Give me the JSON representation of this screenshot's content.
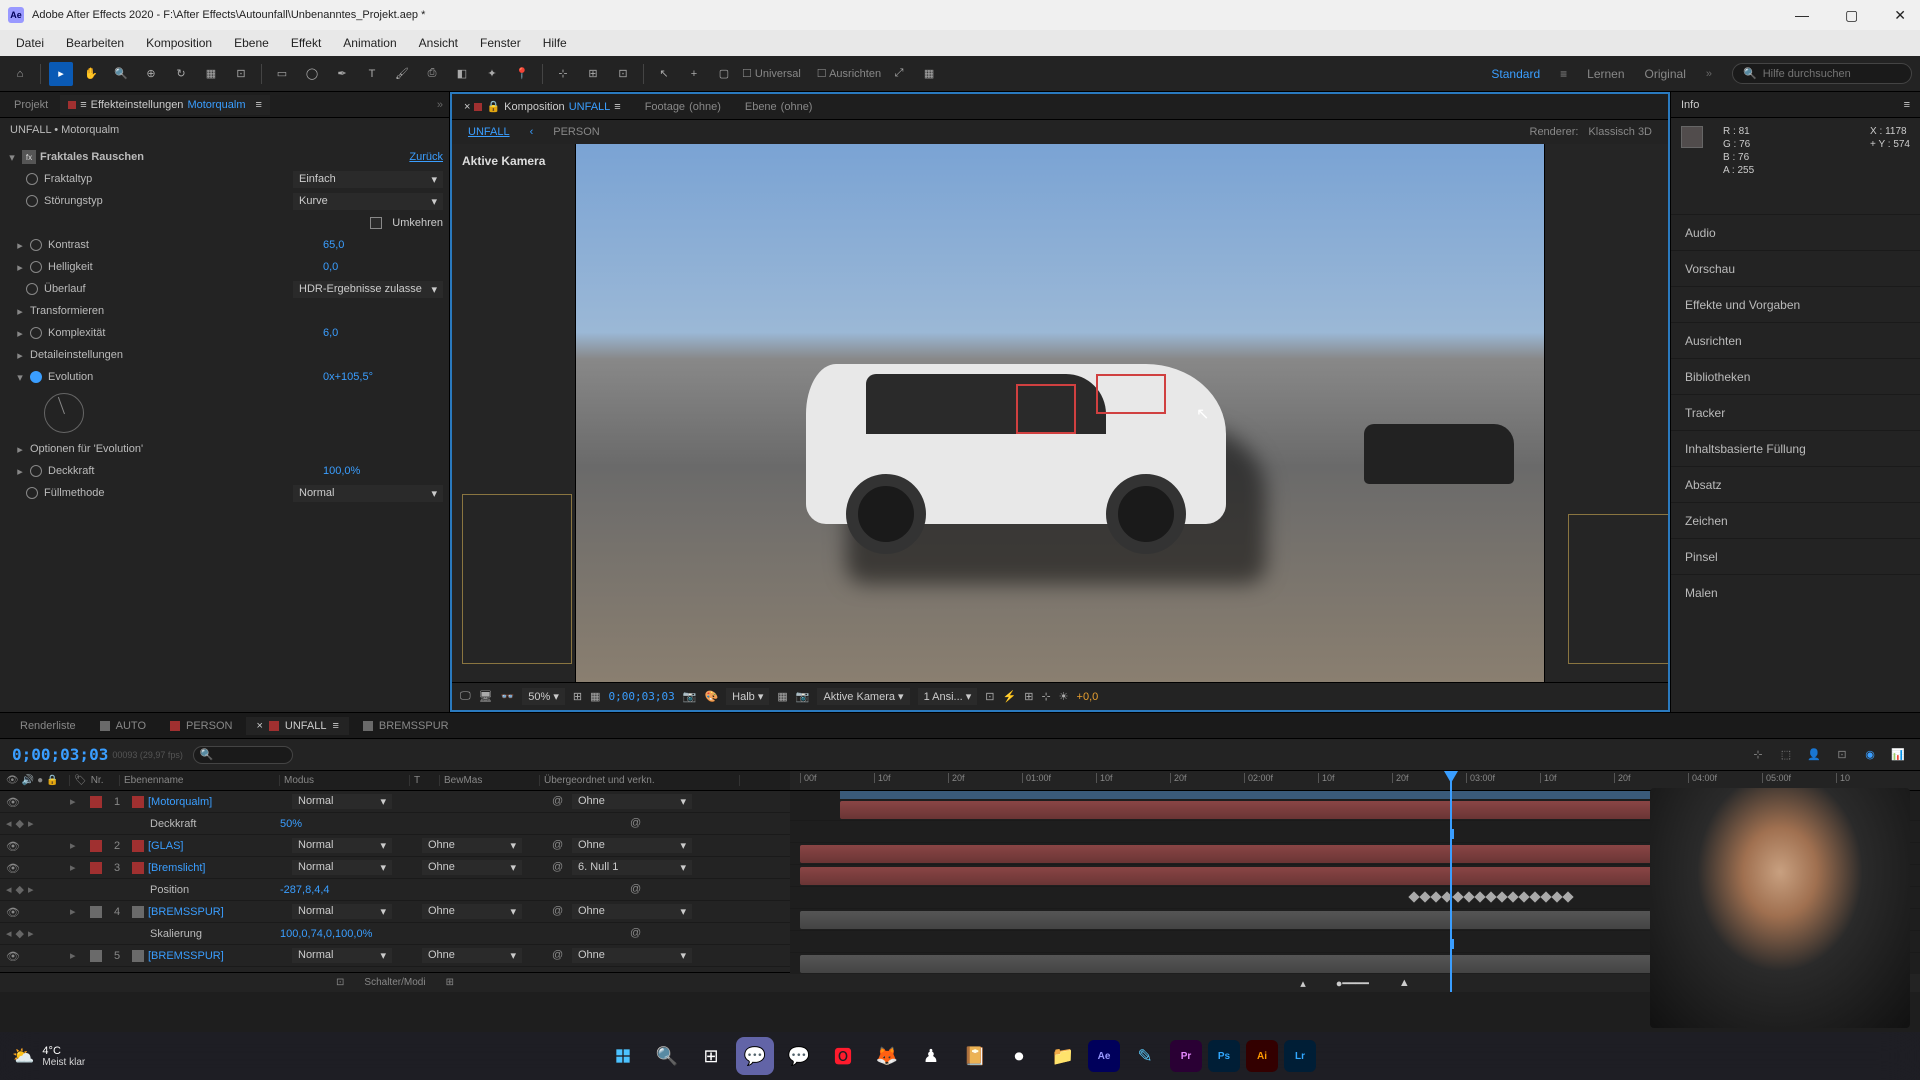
{
  "title": "Adobe After Effects 2020 - F:\\After Effects\\Autounfall\\Unbenanntes_Projekt.aep *",
  "menu": [
    "Datei",
    "Bearbeiten",
    "Komposition",
    "Ebene",
    "Effekt",
    "Animation",
    "Ansicht",
    "Fenster",
    "Hilfe"
  ],
  "toolbar": {
    "snapping": "Universal",
    "align": "Ausrichten"
  },
  "workspaces": {
    "standard": "Standard",
    "learn": "Lernen",
    "original": "Original"
  },
  "search_placeholder": "Hilfe durchsuchen",
  "left_panel": {
    "project_tab": "Projekt",
    "fx_tab": "Effekteinstellungen",
    "fx_target": "Motorqualm",
    "breadcrumb": "UNFALL • Motorqualm",
    "effect_name": "Fraktales Rauschen",
    "reset": "Zurück",
    "props": {
      "fraktaltyp": {
        "label": "Fraktaltyp",
        "value": "Einfach"
      },
      "stoerung": {
        "label": "Störungstyp",
        "value": "Kurve"
      },
      "umkehren": {
        "label": "Umkehren"
      },
      "kontrast": {
        "label": "Kontrast",
        "value": "65,0"
      },
      "helligkeit": {
        "label": "Helligkeit",
        "value": "0,0"
      },
      "ueberlauf": {
        "label": "Überlauf",
        "value": "HDR-Ergebnisse zulasse"
      },
      "transform": {
        "label": "Transformieren"
      },
      "komplex": {
        "label": "Komplexität",
        "value": "6,0"
      },
      "detail": {
        "label": "Detaileinstellungen"
      },
      "evolution": {
        "label": "Evolution",
        "value": "0x+105,5°"
      },
      "evo_opt": {
        "label": "Optionen für 'Evolution'"
      },
      "deckkraft": {
        "label": "Deckkraft",
        "value": "100,0%"
      },
      "fuell": {
        "label": "Füllmethode",
        "value": "Normal"
      }
    }
  },
  "comp": {
    "tab_label": "Komposition",
    "tab_name": "UNFALL",
    "footage": "Footage",
    "none": "(ohne)",
    "layer": "Ebene",
    "sub_active": "UNFALL",
    "sub_back": "‹",
    "sub_person": "PERSON",
    "renderer_label": "Renderer:",
    "renderer": "Klassisch 3D",
    "active_cam": "Aktive Kamera"
  },
  "viewer_controls": {
    "zoom": "50%",
    "time": "0;00;03;03",
    "res": "Halb",
    "camera": "Aktive Kamera",
    "views": "1 Ansi...",
    "exposure": "+0,0"
  },
  "info": {
    "tab": "Info",
    "r": "R :",
    "r_v": "81",
    "g": "G :",
    "g_v": "76",
    "b": "B :",
    "b_v": "76",
    "a": "A :",
    "a_v": "255",
    "x": "X :",
    "x_v": "1178",
    "y": "Y :",
    "y_v": "574"
  },
  "side_panels": [
    "Audio",
    "Vorschau",
    "Effekte und Vorgaben",
    "Ausrichten",
    "Bibliotheken",
    "Tracker",
    "Inhaltsbasierte Füllung",
    "Absatz",
    "Zeichen",
    "Pinsel",
    "Malen"
  ],
  "timeline": {
    "tabs": {
      "render": "Renderliste",
      "auto": "AUTO",
      "person": "PERSON",
      "unfall": "UNFALL",
      "brems": "BREMSSPUR"
    },
    "timecode": "0;00;03;03",
    "timecode_sub": "00093 (29,97 fps)",
    "cols": {
      "nr": "Nr.",
      "name": "Ebenenname",
      "mode": "Modus",
      "trk": "T",
      "bew": "BewMas",
      "parent": "Übergeordnet und verkn."
    },
    "layers": [
      {
        "idx": "1",
        "name": "[Motorqualm]",
        "mode": "Normal",
        "parent": "Ohne",
        "color": "#a03030",
        "props": [
          {
            "name": "Deckkraft",
            "value": "50%"
          }
        ]
      },
      {
        "idx": "2",
        "name": "[GLAS]",
        "mode": "Normal",
        "trk": "Ohne",
        "parent": "Ohne",
        "color": "#a03030"
      },
      {
        "idx": "3",
        "name": "[Bremslicht]",
        "mode": "Normal",
        "trk": "Ohne",
        "parent": "6. Null 1",
        "color": "#a03030",
        "props": [
          {
            "name": "Position",
            "value": "-287,8,4,4"
          }
        ]
      },
      {
        "idx": "4",
        "name": "[BREMSSPUR]",
        "mode": "Normal",
        "trk": "Ohne",
        "parent": "Ohne",
        "color": "#6a6a6a",
        "props": [
          {
            "name": "Skalierung",
            "value": "100,0,74,0,100,0%"
          }
        ]
      },
      {
        "idx": "5",
        "name": "[BREMSSPUR]",
        "mode": "Normal",
        "trk": "Ohne",
        "parent": "Ohne",
        "color": "#6a6a6a"
      }
    ],
    "ruler": [
      "00f",
      "10f",
      "20f",
      "01:00f",
      "10f",
      "20f",
      "02:00f",
      "10f",
      "20f",
      "03:00f",
      "10f",
      "20f",
      "04:00f",
      "05:00f",
      "10"
    ],
    "footer": "Schalter/Modi"
  },
  "taskbar": {
    "temp": "4°C",
    "weather": "Meist klar"
  }
}
